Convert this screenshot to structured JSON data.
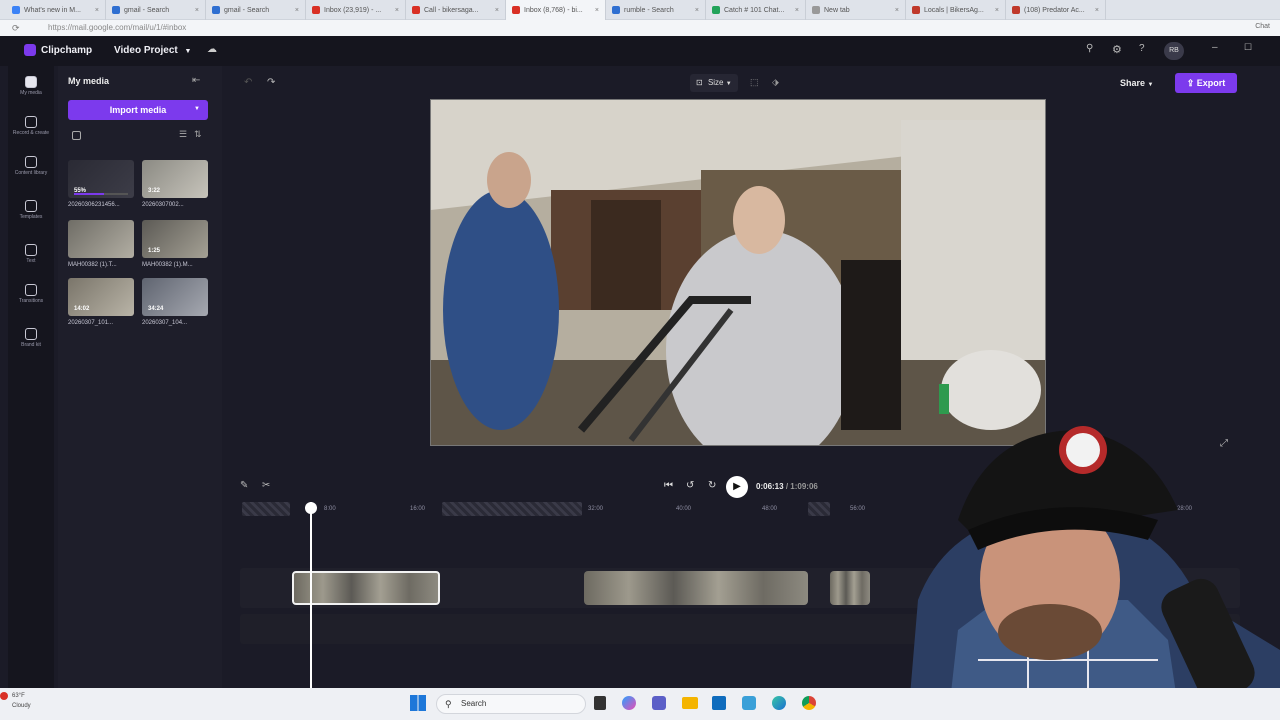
{
  "browser": {
    "tabs": [
      {
        "label": "What's new in M...",
        "color": "#3b82f6",
        "active": false
      },
      {
        "label": "gmail - Search",
        "color": "#2f6fd1",
        "active": false
      },
      {
        "label": "gmail - Search",
        "color": "#2f6fd1",
        "active": false
      },
      {
        "label": "Inbox (23,919) - ...",
        "color": "#d93025",
        "active": false
      },
      {
        "label": "Call - bikersaga...",
        "color": "#d93025",
        "active": false
      },
      {
        "label": "Inbox (8,768) - bi...",
        "color": "#d93025",
        "active": true
      },
      {
        "label": "rumble - Search",
        "color": "#2f6fd1",
        "active": false
      },
      {
        "label": "Catch # 101 Chat...",
        "color": "#22a35a",
        "active": false
      },
      {
        "label": "New tab",
        "color": "#999999",
        "active": false
      },
      {
        "label": "Locals | BikersAg...",
        "color": "#c0392b",
        "active": false
      },
      {
        "label": "(108) Predator Ac...",
        "color": "#c0392b",
        "active": false
      }
    ],
    "url": "https://mail.google.com/mail/u/1/#inbox",
    "chat_label": "Chat"
  },
  "app": {
    "name": "Clipchamp",
    "project_name": "Video Project",
    "avatar_initials": "RB",
    "share_label": "Share",
    "export_label": "Export",
    "size_label": "Size",
    "accent": "#7c3aed"
  },
  "rail": [
    {
      "label": "My media",
      "icon": "media-icon"
    },
    {
      "label": "Record & create",
      "icon": "camera-icon"
    },
    {
      "label": "Content library",
      "icon": "library-icon"
    },
    {
      "label": "Templates",
      "icon": "templates-icon"
    },
    {
      "label": "Text",
      "icon": "text-icon"
    },
    {
      "label": "Transitions",
      "icon": "transitions-icon"
    },
    {
      "label": "Brand kit",
      "icon": "brand-kit-icon"
    }
  ],
  "media": {
    "title": "My media",
    "import_label": "Import media",
    "items": [
      {
        "name": "20260306231456...",
        "duration": "55%",
        "progress": 0.55
      },
      {
        "name": "20260307002...",
        "duration": "3:22"
      },
      {
        "name": "MAH00382 (1).T...",
        "duration": ""
      },
      {
        "name": "MAH00382 (1).M...",
        "duration": "1:25"
      },
      {
        "name": "20260307_101...",
        "duration": "14:02"
      },
      {
        "name": "20260307_104...",
        "duration": "34:24"
      }
    ]
  },
  "playback": {
    "current": "0:06:13",
    "total": "1:09:06",
    "separator": "/"
  },
  "ruler": [
    "0",
    "8:00",
    "16:00",
    "24:00",
    "32:00",
    "40:00",
    "48:00",
    "56:00",
    "1:28:00"
  ],
  "taskbar": {
    "weather_temp": "63°F",
    "weather_desc": "Cloudy",
    "search_label": "Search"
  }
}
